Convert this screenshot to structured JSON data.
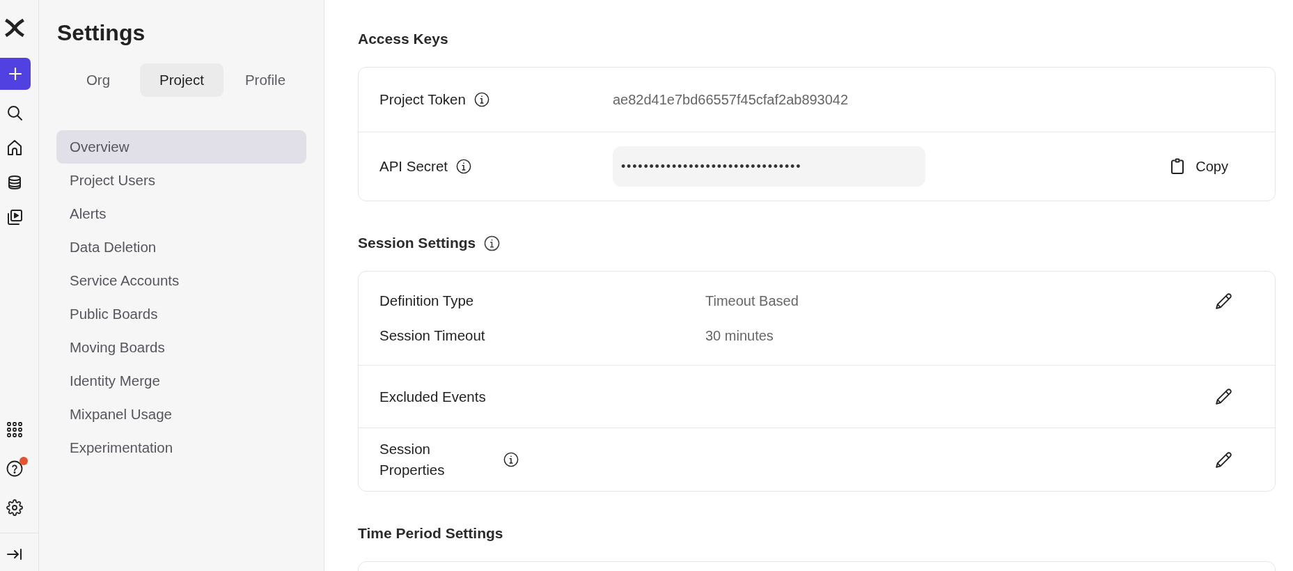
{
  "rail": {
    "help": {
      "notification": true
    }
  },
  "sidebar": {
    "title": "Settings",
    "tabs": [
      {
        "label": "Org",
        "selected": false
      },
      {
        "label": "Project",
        "selected": true
      },
      {
        "label": "Profile",
        "selected": false
      }
    ],
    "items": [
      {
        "label": "Overview",
        "selected": true
      },
      {
        "label": "Project Users",
        "selected": false
      },
      {
        "label": "Alerts",
        "selected": false
      },
      {
        "label": "Data Deletion",
        "selected": false
      },
      {
        "label": "Service Accounts",
        "selected": false
      },
      {
        "label": "Public Boards",
        "selected": false
      },
      {
        "label": "Moving Boards",
        "selected": false
      },
      {
        "label": "Identity Merge",
        "selected": false
      },
      {
        "label": "Mixpanel Usage",
        "selected": false
      },
      {
        "label": "Experimentation",
        "selected": false
      }
    ]
  },
  "sections": [
    {
      "title": "Access Keys",
      "info": false,
      "rows": [
        {
          "kind": "value",
          "label": "Project Token",
          "info": true,
          "value": "ae82d41e7bd66557f45cfaf2ab893042",
          "editable": false
        },
        {
          "kind": "secret",
          "label": "API Secret",
          "info": true,
          "value": "••••••••••••••••••••••••••••••••",
          "action": "Copy",
          "editable": false
        }
      ]
    },
    {
      "title": "Session Settings",
      "info": true,
      "rows": [
        {
          "kind": "pairs",
          "pairs": [
            {
              "label": "Definition Type",
              "value": "Timeout Based"
            },
            {
              "label": "Session Timeout",
              "value": "30 minutes"
            }
          ],
          "editable": true
        },
        {
          "kind": "label",
          "label": "Excluded Events",
          "info": false,
          "editable": true
        },
        {
          "kind": "label",
          "label": "Session Properties",
          "info": true,
          "editable": true
        }
      ]
    },
    {
      "title": "Time Period Settings",
      "info": false
    }
  ]
}
